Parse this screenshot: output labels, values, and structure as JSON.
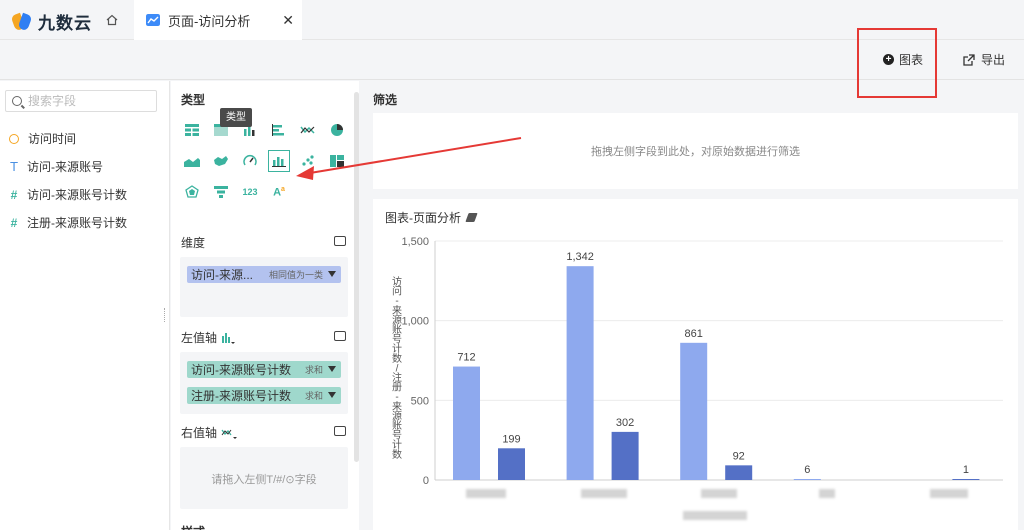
{
  "app": {
    "logo_text": "九数云"
  },
  "tabs": [
    {
      "label": "页面-访问分析"
    }
  ],
  "toolbar": {
    "chart_label": "图表",
    "export_label": "导出"
  },
  "fields": {
    "search_placeholder": "搜索字段",
    "items": [
      {
        "label": "访问时间",
        "kind": "time"
      },
      {
        "label": "访问-来源账号",
        "kind": "text"
      },
      {
        "label": "访问-来源账号计数",
        "kind": "number"
      },
      {
        "label": "注册-来源账号计数",
        "kind": "number"
      }
    ]
  },
  "config": {
    "type_title": "类型",
    "type_tooltip": "类型",
    "dimension_label": "维度",
    "dimension_pill": {
      "label": "访问-来源...",
      "sub": "相同值为一类"
    },
    "left_axis_label": "左值轴",
    "left_axis_pills": [
      {
        "label": "访问-来源账号计数",
        "sub": "求和"
      },
      {
        "label": "注册-来源账号计数",
        "sub": "求和"
      }
    ],
    "right_axis_label": "右值轴",
    "right_axis_hint": "请拖入左侧T/#/⊙字段",
    "style_label": "样式"
  },
  "filter": {
    "title": "筛选",
    "hint": "拖拽左侧字段到此处，对原始数据进行筛选"
  },
  "chart_data": {
    "type": "bar",
    "title": "图表-页面分析",
    "ylabel": "访问-来源账号计数/注册-来源账号计数",
    "ylim": [
      0,
      1500
    ],
    "yticks": [
      0,
      500,
      1000,
      1500
    ],
    "ytick_labels": [
      "0",
      "500",
      "1,000",
      "1,500"
    ],
    "categories": [
      "",
      "",
      "",
      "",
      ""
    ],
    "series": [
      {
        "values": [
          712,
          1342,
          861,
          6,
          null
        ],
        "color": "#8ea9ee"
      },
      {
        "values": [
          199,
          302,
          92,
          null,
          1
        ],
        "color": "#5470c6"
      }
    ],
    "value_labels": [
      [
        "712",
        "1,342",
        "861",
        "6",
        ""
      ],
      [
        "199",
        "302",
        "92",
        "",
        "1"
      ]
    ],
    "grid": true
  }
}
